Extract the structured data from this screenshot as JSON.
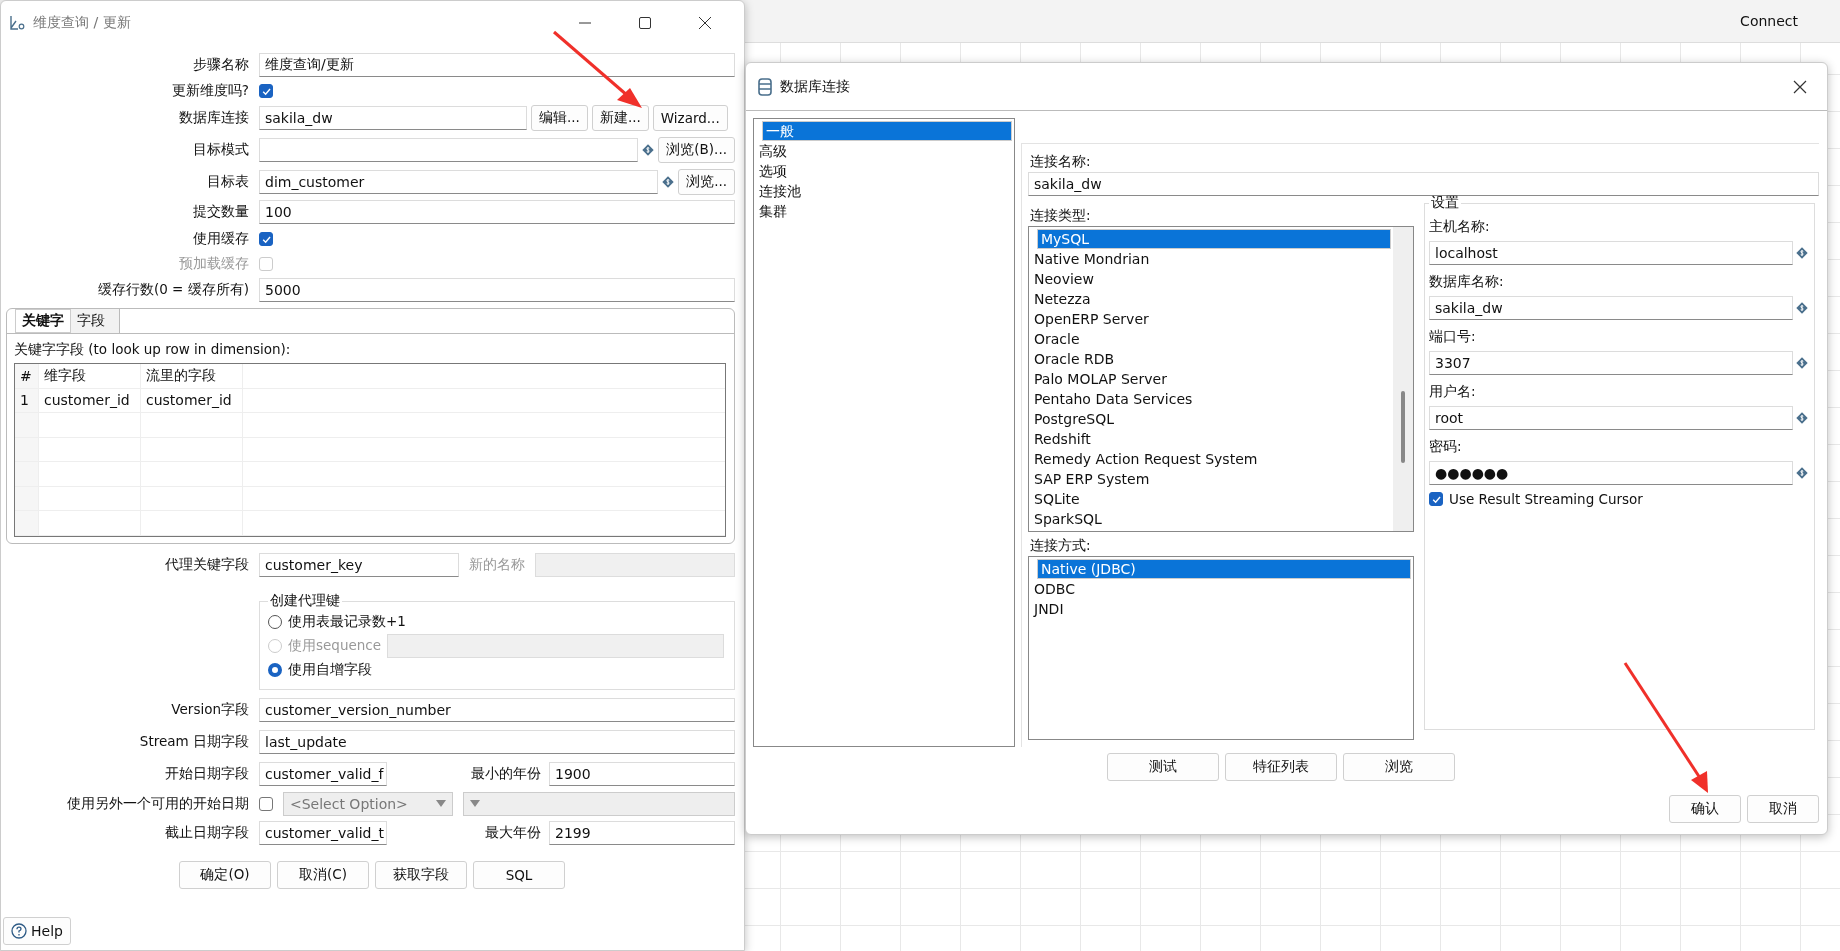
{
  "app": {
    "connect_label": "Connect"
  },
  "lookup_dialog": {
    "title": "维度查询 / 更新",
    "step_name": {
      "label": "步骤名称",
      "value": "维度查询/更新"
    },
    "update_dimension": {
      "label": "更新维度吗?",
      "checked": true
    },
    "connection": {
      "label": "数据库连接",
      "value": "sakila_dw",
      "buttons": [
        "编辑...",
        "新建...",
        "Wizard..."
      ]
    },
    "target_schema": {
      "label": "目标模式",
      "button": "浏览(B)..."
    },
    "target_table": {
      "label": "目标表",
      "value": "dim_customer",
      "button": "浏览..."
    },
    "commit_size": {
      "label": "提交数量",
      "value": "100"
    },
    "use_cache": {
      "label": "使用缓存",
      "checked": true,
      "disabled": false
    },
    "preload_cache": {
      "label": "预加载缓存",
      "checked": false,
      "disabled": true
    },
    "cache_rows": {
      "label": "缓存行数(0 = 缓存所有)",
      "value": "5000"
    },
    "tabs": [
      {
        "label": "关键字",
        "selected": true
      },
      {
        "label": "字段",
        "selected": false
      }
    ],
    "keys_label": "关键字字段 (to look up row in dimension):",
    "table": {
      "columns": [
        "#",
        "维字段",
        "流里的字段"
      ],
      "rows": [
        [
          "1",
          "customer_id",
          "customer_id"
        ]
      ]
    },
    "tech_key": {
      "label": "代理关键字段",
      "value": "customer_key",
      "rename_label": "新的名称"
    },
    "creation_group": {
      "title": "创建代理键",
      "options": [
        {
          "label": "使用表最记录数+1",
          "selected": false,
          "disabled": false
        },
        {
          "label": "使用sequence",
          "selected": false,
          "disabled": true
        },
        {
          "label": "使用自增字段",
          "selected": true,
          "disabled": false
        }
      ]
    },
    "version_field": {
      "label": "Version字段",
      "value": "customer_version_number"
    },
    "stream_date": {
      "label": "Stream 日期字段",
      "value": "last_update"
    },
    "date_from": {
      "label": "开始日期字段",
      "value": "customer_valid_f",
      "year_label": "最小的年份",
      "year": "1900"
    },
    "alt_start": {
      "label": "使用另外一个可用的开始日期",
      "checked": false,
      "placeholder": "<Select Option>"
    },
    "date_to": {
      "label": "截止日期字段",
      "value": "customer_valid_t",
      "year_label": "最大年份",
      "year": "2199"
    },
    "buttons": [
      "确定(O)",
      "取消(C)",
      "获取字段",
      "SQL"
    ],
    "help": "Help"
  },
  "db_dialog": {
    "title": "数据库连接",
    "sections": [
      {
        "label": "一般",
        "selected": true
      },
      {
        "label": "高级",
        "selected": false
      },
      {
        "label": "选项",
        "selected": false
      },
      {
        "label": "连接池",
        "selected": false
      },
      {
        "label": "集群",
        "selected": false
      }
    ],
    "connection_name": {
      "label": "连接名称:",
      "value": "sakila_dw"
    },
    "connection_types": {
      "label": "连接类型:",
      "items": [
        {
          "label": "MySQL",
          "selected": true
        },
        {
          "label": "Native Mondrian",
          "selected": false
        },
        {
          "label": "Neoview",
          "selected": false
        },
        {
          "label": "Netezza",
          "selected": false
        },
        {
          "label": "OpenERP Server",
          "selected": false
        },
        {
          "label": "Oracle",
          "selected": false
        },
        {
          "label": "Oracle RDB",
          "selected": false
        },
        {
          "label": "Palo MOLAP Server",
          "selected": false
        },
        {
          "label": "Pentaho Data Services",
          "selected": false
        },
        {
          "label": "PostgreSQL",
          "selected": false
        },
        {
          "label": "Redshift",
          "selected": false
        },
        {
          "label": "Remedy Action Request System",
          "selected": false
        },
        {
          "label": "SAP ERP System",
          "selected": false
        },
        {
          "label": "SQLite",
          "selected": false
        },
        {
          "label": "SparkSQL",
          "selected": false
        }
      ]
    },
    "access": {
      "label": "连接方式:",
      "items": [
        {
          "label": "Native (JDBC)",
          "selected": true
        },
        {
          "label": "ODBC",
          "selected": false
        },
        {
          "label": "JNDI",
          "selected": false
        }
      ]
    },
    "settings": {
      "title": "设置",
      "fields": [
        {
          "label": "主机名称:",
          "value": "localhost"
        },
        {
          "label": "数据库名称:",
          "value": "sakila_dw"
        },
        {
          "label": "端口号:",
          "value": "3307"
        },
        {
          "label": "用户名:",
          "value": "root"
        },
        {
          "label": "密码:",
          "value": "●●●●●●"
        }
      ],
      "streaming": {
        "label": "Use Result Streaming Cursor",
        "checked": true
      }
    },
    "buttons": [
      "测试",
      "特征列表",
      "浏览"
    ],
    "footer_buttons": [
      "确认",
      "取消"
    ]
  }
}
